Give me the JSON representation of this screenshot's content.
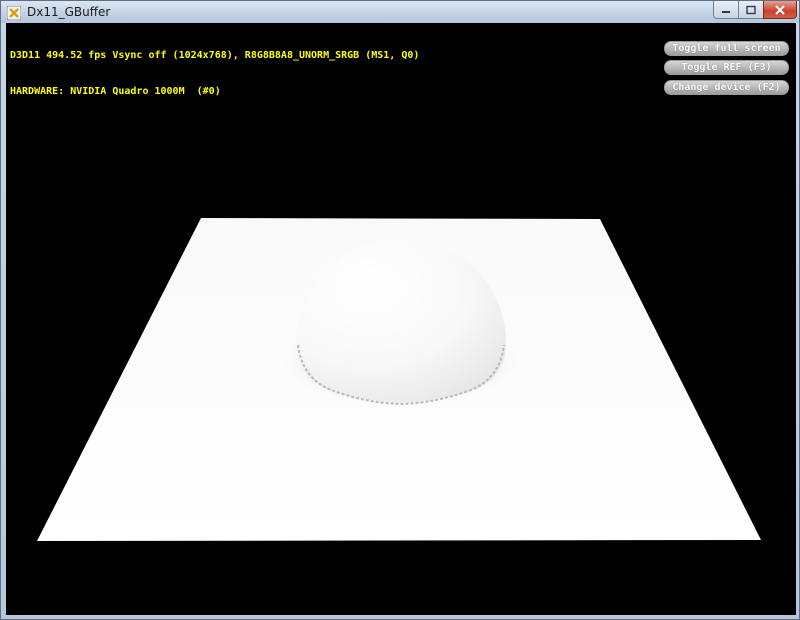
{
  "window": {
    "title": "Dx11_GBuffer",
    "icons": {
      "app": "dx-app-icon",
      "minimize": "minimize-icon",
      "maximize": "maximize-icon",
      "close": "close-icon"
    }
  },
  "stats": {
    "line1": "D3D11 494.52 fps Vsync off (1024x768), R8G8B8A8_UNORM_SRGB (MS1, Q0)",
    "line2": "HARDWARE: NVIDIA Quadro 1000M  (#0)"
  },
  "hud_buttons": [
    {
      "label": "Toggle full screen"
    },
    {
      "label": "Toggle REF (F3)"
    },
    {
      "label": "Change device (F2)"
    }
  ],
  "colors": {
    "stats_text": "#ffff00",
    "viewport_bg": "#000000",
    "plane": "#ffffff"
  }
}
